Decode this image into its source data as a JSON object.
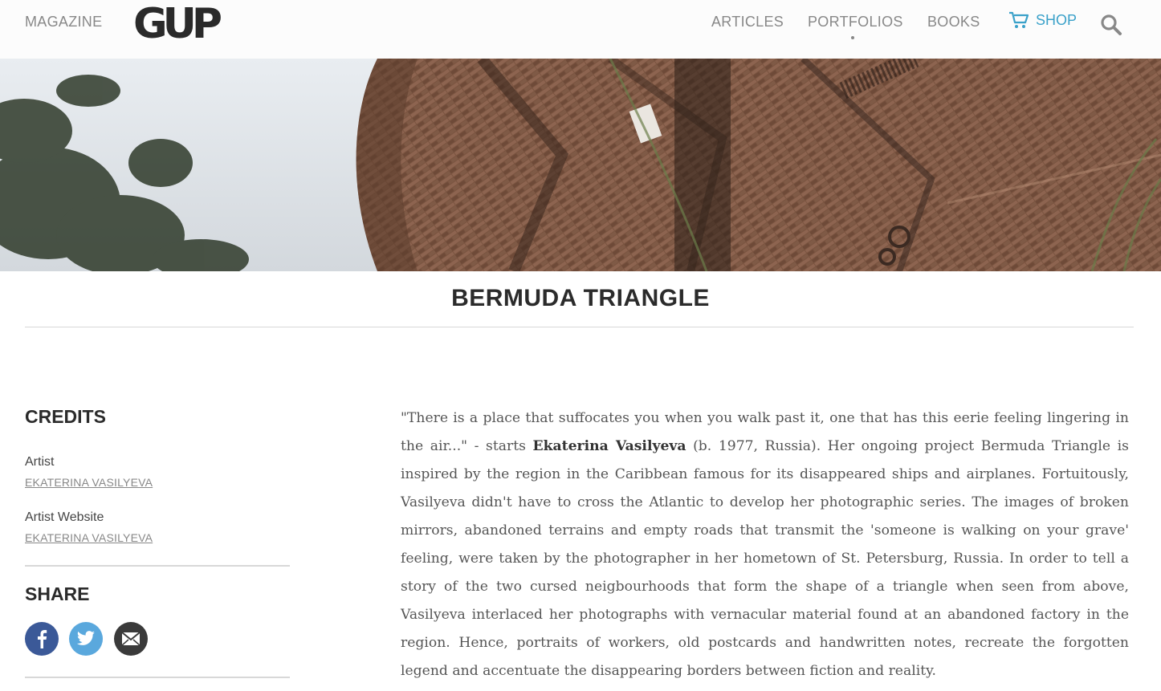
{
  "header": {
    "magazine_label": "MAGAZINE",
    "logo_text": "GUP",
    "nav": {
      "articles": "ARTICLES",
      "portfolios": "PORTFOLIOS",
      "books": "BOOKS",
      "shop": "SHOP"
    },
    "accent_color": "#3aa1c9",
    "icons": [
      "cart-icon",
      "search-icon"
    ]
  },
  "article": {
    "title": "BERMUDA TRIANGLE",
    "body_before_name": "\"There is a place that suffocates you when you walk past it, one that has this eerie feeling lingering in the air...\" - starts ",
    "artist_name": "Ekaterina Vasilyeva",
    "body_after_name": " (b. 1977, Russia). Her ongoing project Bermuda Triangle is inspired by the region in the Caribbean famous for its disappeared ships and airplanes. Fortuitously, Vasilyeva didn't have to cross the Atlantic to develop her photographic series. The images of broken mirrors, abandoned terrains and empty roads that transmit the 'someone is walking on your grave' feeling, were taken by the photographer in her hometown of St. Petersburg, Russia. In order to tell a story of the two cursed neigbourhoods that form the shape of a triangle when seen from above, Vasilyeva interlaced her photographs with vernacular material found at an abandoned factory in the region. Hence, portraits of workers, old postcards and handwritten notes, recreate the forgotten legend and accentuate the disappearing borders between fiction and reality."
  },
  "sidebar": {
    "credits_heading": "CREDITS",
    "credits": [
      {
        "label": "Artist",
        "value": "EKATERINA VASILYEVA"
      },
      {
        "label": "Artist Website",
        "value": "EKATERINA VASILYEVA"
      }
    ],
    "share_heading": "SHARE",
    "share_icons": [
      "facebook-icon",
      "twitter-icon",
      "email-icon"
    ]
  }
}
